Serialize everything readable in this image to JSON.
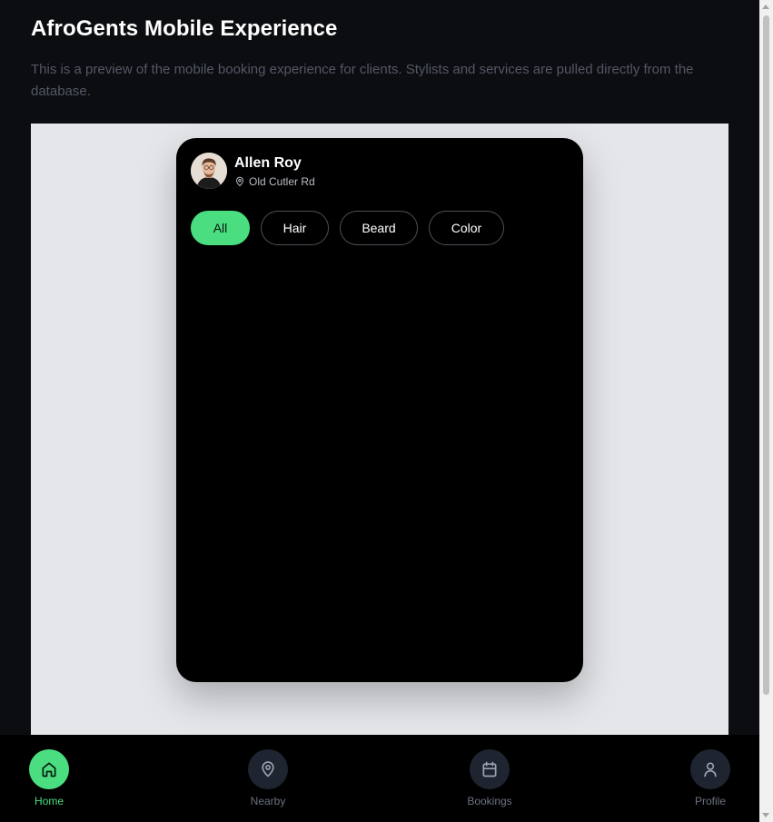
{
  "header": {
    "title": "AfroGents Mobile Experience",
    "description": "This is a preview of the mobile booking experience for clients. Stylists and services are pulled directly from the database."
  },
  "phone": {
    "user": {
      "name": "Allen Roy",
      "location": "Old Cutler Rd",
      "avatar_icon": "user-photo"
    },
    "chips": [
      {
        "label": "All",
        "active": true
      },
      {
        "label": "Hair",
        "active": false
      },
      {
        "label": "Beard",
        "active": false
      },
      {
        "label": "Color",
        "active": false
      }
    ]
  },
  "bottom_nav": {
    "items": [
      {
        "label": "Home",
        "icon": "home-icon",
        "active": true
      },
      {
        "label": "Nearby",
        "icon": "map-pin-icon",
        "active": false
      },
      {
        "label": "Bookings",
        "icon": "calendar-icon",
        "active": false
      },
      {
        "label": "Profile",
        "icon": "user-icon",
        "active": false
      }
    ]
  },
  "colors": {
    "accent": "#4ade80",
    "background": "#0c0d10",
    "preview_bg": "#e4e6ea",
    "nav_bg": "#000000"
  }
}
